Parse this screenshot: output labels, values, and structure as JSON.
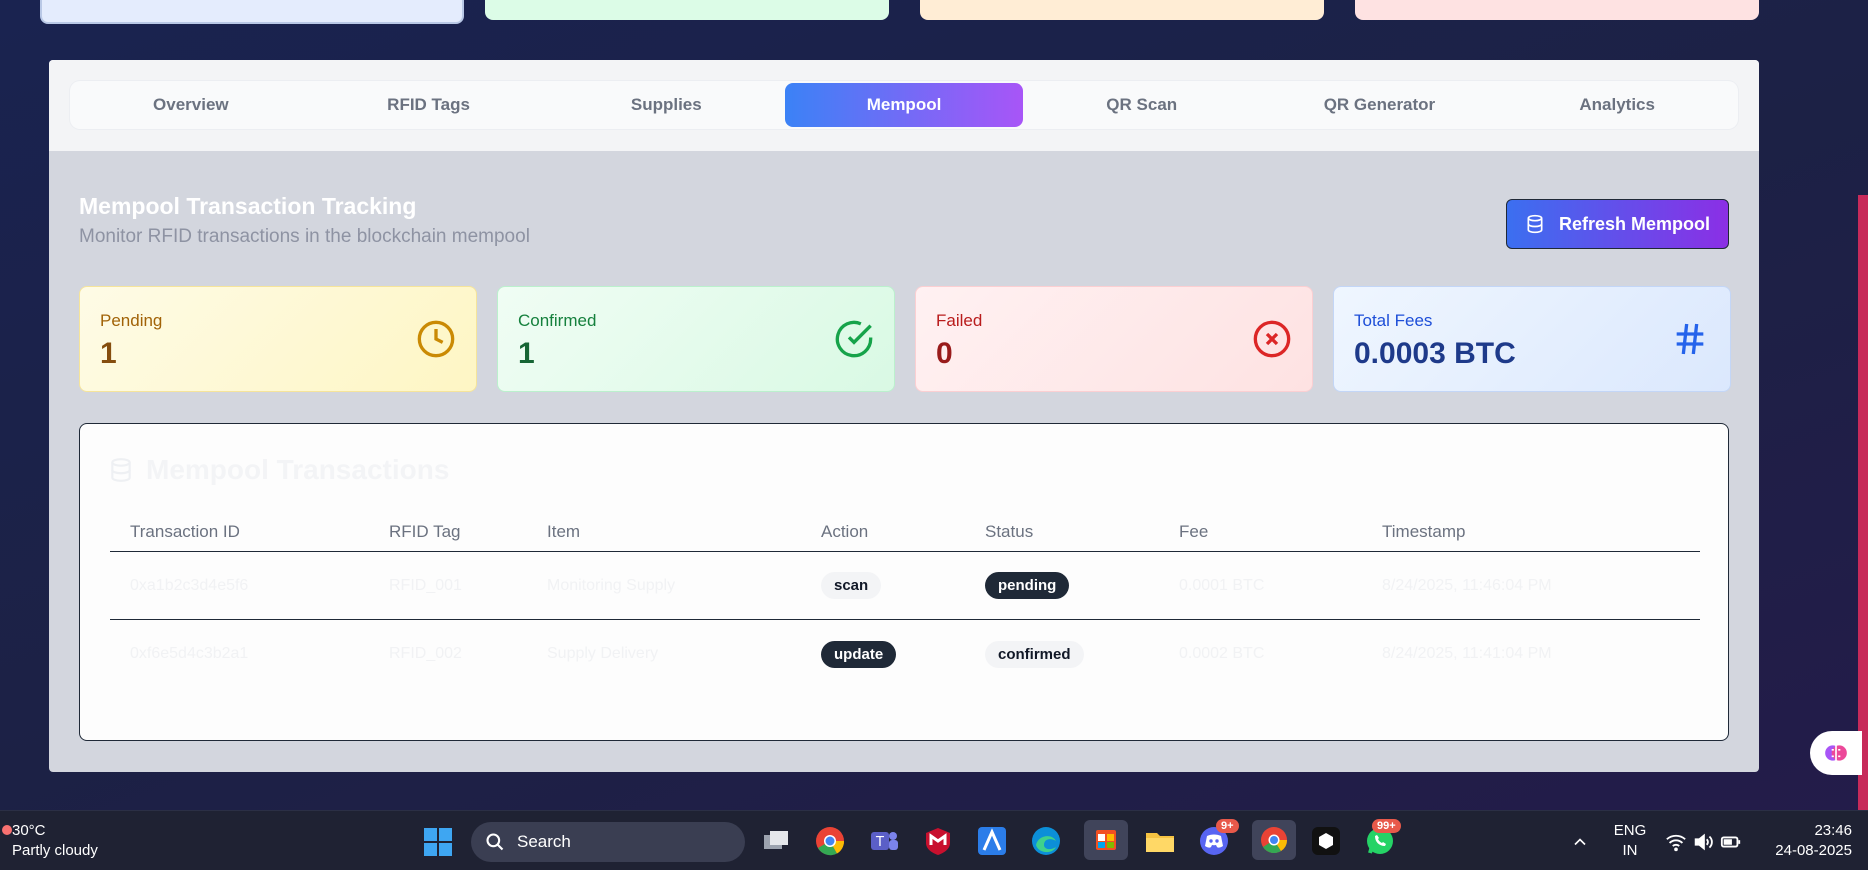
{
  "tabs": [
    {
      "label": "Overview"
    },
    {
      "label": "RFID Tags"
    },
    {
      "label": "Supplies"
    },
    {
      "label": "Mempool"
    },
    {
      "label": "QR Scan"
    },
    {
      "label": "QR Generator"
    },
    {
      "label": "Analytics"
    }
  ],
  "header": {
    "title": "Mempool Transaction Tracking",
    "subtitle": "Monitor RFID transactions in the blockchain mempool",
    "refresh_label": "Refresh Mempool"
  },
  "stats": {
    "pending": {
      "label": "Pending",
      "value": "1"
    },
    "confirmed": {
      "label": "Confirmed",
      "value": "1"
    },
    "failed": {
      "label": "Failed",
      "value": "0"
    },
    "fees": {
      "label": "Total Fees",
      "value": "0.0003 BTC"
    }
  },
  "table": {
    "title": "Mempool Transactions",
    "columns": [
      "Transaction ID",
      "RFID Tag",
      "Item",
      "Action",
      "Status",
      "Fee",
      "Timestamp"
    ],
    "rows": [
      {
        "txid": "0xa1b2c3d4e5f6",
        "tag": "RFID_001",
        "item": "Monitoring Supply",
        "action": "scan",
        "status": "pending",
        "fee": "0.0001 BTC",
        "timestamp": "8/24/2025, 11:46:04 PM"
      },
      {
        "txid": "0xf6e5d4c3b2a1",
        "tag": "RFID_002",
        "item": "Supply Delivery",
        "action": "update",
        "status": "confirmed",
        "fee": "0.0002 BTC",
        "timestamp": "8/24/2025, 11:41:04 PM"
      }
    ]
  },
  "taskbar": {
    "temperature": "30°C",
    "weather": "Partly cloudy",
    "search_label": "Search",
    "discord_badge": "9+",
    "whatsapp_badge": "99+",
    "lang_1": "ENG",
    "lang_2": "IN",
    "time": "23:46",
    "date": "24-08-2025"
  }
}
